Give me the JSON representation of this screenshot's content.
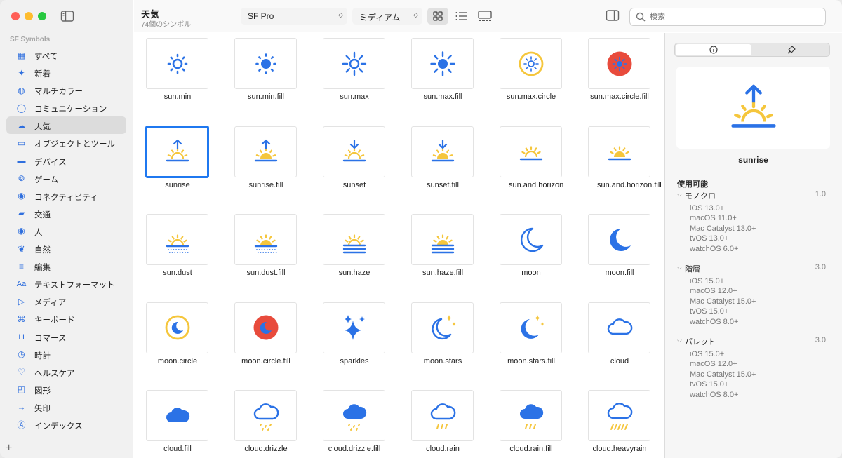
{
  "sidebar": {
    "heading": "SF Symbols",
    "items": [
      {
        "label": "すべて",
        "icon": "grid-icon",
        "selected": false
      },
      {
        "label": "新着",
        "icon": "sparkle-icon",
        "selected": false
      },
      {
        "label": "マルチカラー",
        "icon": "palette-icon",
        "selected": false
      },
      {
        "label": "コミュニケーション",
        "icon": "message-bubble-icon",
        "selected": false
      },
      {
        "label": "天気",
        "icon": "cloud-sun-icon",
        "selected": true
      },
      {
        "label": "オブジェクトとツール",
        "icon": "folder-icon",
        "selected": false
      },
      {
        "label": "デバイス",
        "icon": "display-icon",
        "selected": false
      },
      {
        "label": "ゲーム",
        "icon": "gamecontroller-icon",
        "selected": false
      },
      {
        "label": "コネクティビティ",
        "icon": "antenna-icon",
        "selected": false
      },
      {
        "label": "交通",
        "icon": "car-icon",
        "selected": false
      },
      {
        "label": "人",
        "icon": "person-circle-icon",
        "selected": false
      },
      {
        "label": "自然",
        "icon": "leaf-icon",
        "selected": false
      },
      {
        "label": "編集",
        "icon": "sliders-icon",
        "selected": false
      },
      {
        "label": "テキストフォーマット",
        "icon": "textformat-icon",
        "selected": false
      },
      {
        "label": "メディア",
        "icon": "playpause-icon",
        "selected": false
      },
      {
        "label": "キーボード",
        "icon": "command-icon",
        "selected": false
      },
      {
        "label": "コマース",
        "icon": "cart-icon",
        "selected": false
      },
      {
        "label": "時計",
        "icon": "clock-icon",
        "selected": false
      },
      {
        "label": "ヘルスケア",
        "icon": "heart-icon",
        "selected": false
      },
      {
        "label": "図形",
        "icon": "shapes-icon",
        "selected": false
      },
      {
        "label": "矢印",
        "icon": "arrow-right-icon",
        "selected": false
      },
      {
        "label": "インデックス",
        "icon": "a-circle-icon",
        "selected": false
      }
    ],
    "add_label": "+"
  },
  "toolbar": {
    "title": "天気",
    "subtitle": "74個のシンボル",
    "font": "SF Pro",
    "weight": "ミディアム",
    "search_placeholder": "検索",
    "active_view": "grid"
  },
  "colors": {
    "accent": "#2f6fde",
    "symbol_blue": "#2b72e6",
    "symbol_yellow": "#f5c63c",
    "symbol_red": "#e84b3c",
    "selection": "#1f78f0"
  },
  "symbols": [
    {
      "name": "sun.min",
      "glyph": "sun-min",
      "selected": false
    },
    {
      "name": "sun.min.fill",
      "glyph": "sun-min-fill",
      "selected": false
    },
    {
      "name": "sun.max",
      "glyph": "sun-max",
      "selected": false
    },
    {
      "name": "sun.max.fill",
      "glyph": "sun-max-fill",
      "selected": false
    },
    {
      "name": "sun.max.circle",
      "glyph": "sun-max-circle",
      "selected": false
    },
    {
      "name": "sun.max.circle.fill",
      "glyph": "sun-max-circle-fill",
      "selected": false
    },
    {
      "name": "sunrise",
      "glyph": "sunrise",
      "selected": true
    },
    {
      "name": "sunrise.fill",
      "glyph": "sunrise-fill",
      "selected": false
    },
    {
      "name": "sunset",
      "glyph": "sunset",
      "selected": false
    },
    {
      "name": "sunset.fill",
      "glyph": "sunset-fill",
      "selected": false
    },
    {
      "name": "sun.and.horizon",
      "glyph": "sun-horizon",
      "selected": false
    },
    {
      "name": "sun.and.horizon.fill",
      "glyph": "sun-horizon-fill",
      "selected": false
    },
    {
      "name": "sun.dust",
      "glyph": "sun-dust",
      "selected": false
    },
    {
      "name": "sun.dust.fill",
      "glyph": "sun-dust-fill",
      "selected": false
    },
    {
      "name": "sun.haze",
      "glyph": "sun-haze",
      "selected": false
    },
    {
      "name": "sun.haze.fill",
      "glyph": "sun-haze-fill",
      "selected": false
    },
    {
      "name": "moon",
      "glyph": "moon",
      "selected": false
    },
    {
      "name": "moon.fill",
      "glyph": "moon-fill",
      "selected": false
    },
    {
      "name": "moon.circle",
      "glyph": "moon-circle",
      "selected": false
    },
    {
      "name": "moon.circle.fill",
      "glyph": "moon-circle-fill",
      "selected": false
    },
    {
      "name": "sparkles",
      "glyph": "sparkles",
      "selected": false
    },
    {
      "name": "moon.stars",
      "glyph": "moon-stars",
      "selected": false
    },
    {
      "name": "moon.stars.fill",
      "glyph": "moon-stars-fill",
      "selected": false
    },
    {
      "name": "cloud",
      "glyph": "cloud",
      "selected": false
    },
    {
      "name": "cloud.fill",
      "glyph": "cloud-fill",
      "selected": false
    },
    {
      "name": "cloud.drizzle",
      "glyph": "cloud-drizzle",
      "selected": false
    },
    {
      "name": "cloud.drizzle.fill",
      "glyph": "cloud-drizzle-fill",
      "selected": false
    },
    {
      "name": "cloud.rain",
      "glyph": "cloud-rain",
      "selected": false
    },
    {
      "name": "cloud.rain.fill",
      "glyph": "cloud-rain-fill",
      "selected": false
    },
    {
      "name": "cloud.heavyrain",
      "glyph": "cloud-heavyrain",
      "selected": false
    }
  ],
  "inspector": {
    "tabs": [
      {
        "icon": "info-icon"
      },
      {
        "icon": "paintbrush-icon"
      }
    ],
    "selected_name": "sunrise",
    "availability_title": "使用可能",
    "groups": [
      {
        "name": "モノクロ",
        "version": "1.0",
        "rows": [
          "iOS 13.0+",
          "macOS 11.0+",
          "Mac Catalyst 13.0+",
          "tvOS 13.0+",
          "watchOS 6.0+"
        ]
      },
      {
        "name": "階層",
        "version": "3.0",
        "rows": [
          "iOS 15.0+",
          "macOS 12.0+",
          "Mac Catalyst 15.0+",
          "tvOS 15.0+",
          "watchOS 8.0+"
        ]
      },
      {
        "name": "パレット",
        "version": "3.0",
        "rows": [
          "iOS 15.0+",
          "macOS 12.0+",
          "Mac Catalyst 15.0+",
          "tvOS 15.0+",
          "watchOS 8.0+"
        ]
      }
    ]
  }
}
